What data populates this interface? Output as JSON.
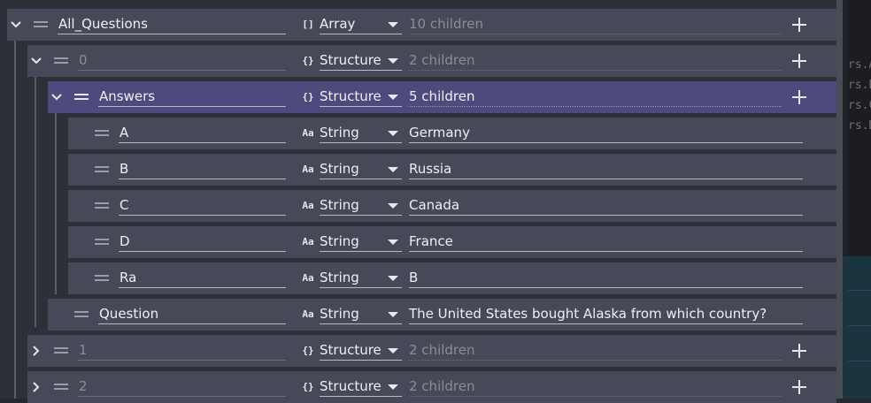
{
  "rows": [
    {
      "name": "All_Questions",
      "type_icon": "[]",
      "type": "Array",
      "value": "10 children"
    },
    {
      "name": "0",
      "type_icon": "{}",
      "type": "Structure",
      "value": "2 children"
    },
    {
      "name": "Answers",
      "type_icon": "{}",
      "type": "Structure",
      "value": "5 children"
    },
    {
      "name": "A",
      "type_icon": "Aa",
      "type": "String",
      "value": "Germany"
    },
    {
      "name": "B",
      "type_icon": "Aa",
      "type": "String",
      "value": "Russia"
    },
    {
      "name": "C",
      "type_icon": "Aa",
      "type": "String",
      "value": "Canada"
    },
    {
      "name": "D",
      "type_icon": "Aa",
      "type": "String",
      "value": "France"
    },
    {
      "name": "Ra",
      "type_icon": "Aa",
      "type": "String",
      "value": "B"
    },
    {
      "name": "Question",
      "type_icon": "Aa",
      "type": "String",
      "value": "The United States bought Alaska from which country?"
    },
    {
      "name": "1",
      "type_icon": "{}",
      "type": "Structure",
      "value": "2 children"
    },
    {
      "name": "2",
      "type_icon": "{}",
      "type": "Structure",
      "value": "2 children"
    }
  ],
  "background_fragments": [
    "rs.A",
    "rs.B",
    "rs.C",
    "rs.D"
  ],
  "icons": {
    "expanded": "chevron-down-icon",
    "collapsed": "chevron-right-icon",
    "drag": "drag-handle-icon",
    "add": "plus-icon"
  },
  "colors": {
    "row": "#464957",
    "selected_row": "#4e4a7d",
    "panel": "#2d2f39"
  }
}
